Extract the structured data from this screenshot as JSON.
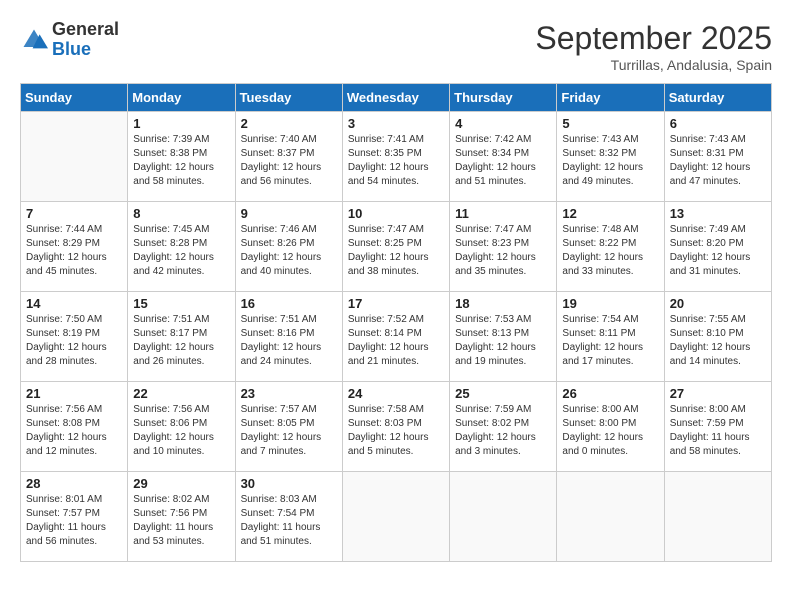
{
  "logo": {
    "text_general": "General",
    "text_blue": "Blue"
  },
  "header": {
    "month_year": "September 2025",
    "location": "Turrillas, Andalusia, Spain"
  },
  "weekdays": [
    "Sunday",
    "Monday",
    "Tuesday",
    "Wednesday",
    "Thursday",
    "Friday",
    "Saturday"
  ],
  "weeks": [
    [
      {
        "day": "",
        "sunrise": "",
        "sunset": "",
        "daylight": ""
      },
      {
        "day": "1",
        "sunrise": "Sunrise: 7:39 AM",
        "sunset": "Sunset: 8:38 PM",
        "daylight": "Daylight: 12 hours and 58 minutes."
      },
      {
        "day": "2",
        "sunrise": "Sunrise: 7:40 AM",
        "sunset": "Sunset: 8:37 PM",
        "daylight": "Daylight: 12 hours and 56 minutes."
      },
      {
        "day": "3",
        "sunrise": "Sunrise: 7:41 AM",
        "sunset": "Sunset: 8:35 PM",
        "daylight": "Daylight: 12 hours and 54 minutes."
      },
      {
        "day": "4",
        "sunrise": "Sunrise: 7:42 AM",
        "sunset": "Sunset: 8:34 PM",
        "daylight": "Daylight: 12 hours and 51 minutes."
      },
      {
        "day": "5",
        "sunrise": "Sunrise: 7:43 AM",
        "sunset": "Sunset: 8:32 PM",
        "daylight": "Daylight: 12 hours and 49 minutes."
      },
      {
        "day": "6",
        "sunrise": "Sunrise: 7:43 AM",
        "sunset": "Sunset: 8:31 PM",
        "daylight": "Daylight: 12 hours and 47 minutes."
      }
    ],
    [
      {
        "day": "7",
        "sunrise": "Sunrise: 7:44 AM",
        "sunset": "Sunset: 8:29 PM",
        "daylight": "Daylight: 12 hours and 45 minutes."
      },
      {
        "day": "8",
        "sunrise": "Sunrise: 7:45 AM",
        "sunset": "Sunset: 8:28 PM",
        "daylight": "Daylight: 12 hours and 42 minutes."
      },
      {
        "day": "9",
        "sunrise": "Sunrise: 7:46 AM",
        "sunset": "Sunset: 8:26 PM",
        "daylight": "Daylight: 12 hours and 40 minutes."
      },
      {
        "day": "10",
        "sunrise": "Sunrise: 7:47 AM",
        "sunset": "Sunset: 8:25 PM",
        "daylight": "Daylight: 12 hours and 38 minutes."
      },
      {
        "day": "11",
        "sunrise": "Sunrise: 7:47 AM",
        "sunset": "Sunset: 8:23 PM",
        "daylight": "Daylight: 12 hours and 35 minutes."
      },
      {
        "day": "12",
        "sunrise": "Sunrise: 7:48 AM",
        "sunset": "Sunset: 8:22 PM",
        "daylight": "Daylight: 12 hours and 33 minutes."
      },
      {
        "day": "13",
        "sunrise": "Sunrise: 7:49 AM",
        "sunset": "Sunset: 8:20 PM",
        "daylight": "Daylight: 12 hours and 31 minutes."
      }
    ],
    [
      {
        "day": "14",
        "sunrise": "Sunrise: 7:50 AM",
        "sunset": "Sunset: 8:19 PM",
        "daylight": "Daylight: 12 hours and 28 minutes."
      },
      {
        "day": "15",
        "sunrise": "Sunrise: 7:51 AM",
        "sunset": "Sunset: 8:17 PM",
        "daylight": "Daylight: 12 hours and 26 minutes."
      },
      {
        "day": "16",
        "sunrise": "Sunrise: 7:51 AM",
        "sunset": "Sunset: 8:16 PM",
        "daylight": "Daylight: 12 hours and 24 minutes."
      },
      {
        "day": "17",
        "sunrise": "Sunrise: 7:52 AM",
        "sunset": "Sunset: 8:14 PM",
        "daylight": "Daylight: 12 hours and 21 minutes."
      },
      {
        "day": "18",
        "sunrise": "Sunrise: 7:53 AM",
        "sunset": "Sunset: 8:13 PM",
        "daylight": "Daylight: 12 hours and 19 minutes."
      },
      {
        "day": "19",
        "sunrise": "Sunrise: 7:54 AM",
        "sunset": "Sunset: 8:11 PM",
        "daylight": "Daylight: 12 hours and 17 minutes."
      },
      {
        "day": "20",
        "sunrise": "Sunrise: 7:55 AM",
        "sunset": "Sunset: 8:10 PM",
        "daylight": "Daylight: 12 hours and 14 minutes."
      }
    ],
    [
      {
        "day": "21",
        "sunrise": "Sunrise: 7:56 AM",
        "sunset": "Sunset: 8:08 PM",
        "daylight": "Daylight: 12 hours and 12 minutes."
      },
      {
        "day": "22",
        "sunrise": "Sunrise: 7:56 AM",
        "sunset": "Sunset: 8:06 PM",
        "daylight": "Daylight: 12 hours and 10 minutes."
      },
      {
        "day": "23",
        "sunrise": "Sunrise: 7:57 AM",
        "sunset": "Sunset: 8:05 PM",
        "daylight": "Daylight: 12 hours and 7 minutes."
      },
      {
        "day": "24",
        "sunrise": "Sunrise: 7:58 AM",
        "sunset": "Sunset: 8:03 PM",
        "daylight": "Daylight: 12 hours and 5 minutes."
      },
      {
        "day": "25",
        "sunrise": "Sunrise: 7:59 AM",
        "sunset": "Sunset: 8:02 PM",
        "daylight": "Daylight: 12 hours and 3 minutes."
      },
      {
        "day": "26",
        "sunrise": "Sunrise: 8:00 AM",
        "sunset": "Sunset: 8:00 PM",
        "daylight": "Daylight: 12 hours and 0 minutes."
      },
      {
        "day": "27",
        "sunrise": "Sunrise: 8:00 AM",
        "sunset": "Sunset: 7:59 PM",
        "daylight": "Daylight: 11 hours and 58 minutes."
      }
    ],
    [
      {
        "day": "28",
        "sunrise": "Sunrise: 8:01 AM",
        "sunset": "Sunset: 7:57 PM",
        "daylight": "Daylight: 11 hours and 56 minutes."
      },
      {
        "day": "29",
        "sunrise": "Sunrise: 8:02 AM",
        "sunset": "Sunset: 7:56 PM",
        "daylight": "Daylight: 11 hours and 53 minutes."
      },
      {
        "day": "30",
        "sunrise": "Sunrise: 8:03 AM",
        "sunset": "Sunset: 7:54 PM",
        "daylight": "Daylight: 11 hours and 51 minutes."
      },
      {
        "day": "",
        "sunrise": "",
        "sunset": "",
        "daylight": ""
      },
      {
        "day": "",
        "sunrise": "",
        "sunset": "",
        "daylight": ""
      },
      {
        "day": "",
        "sunrise": "",
        "sunset": "",
        "daylight": ""
      },
      {
        "day": "",
        "sunrise": "",
        "sunset": "",
        "daylight": ""
      }
    ]
  ]
}
